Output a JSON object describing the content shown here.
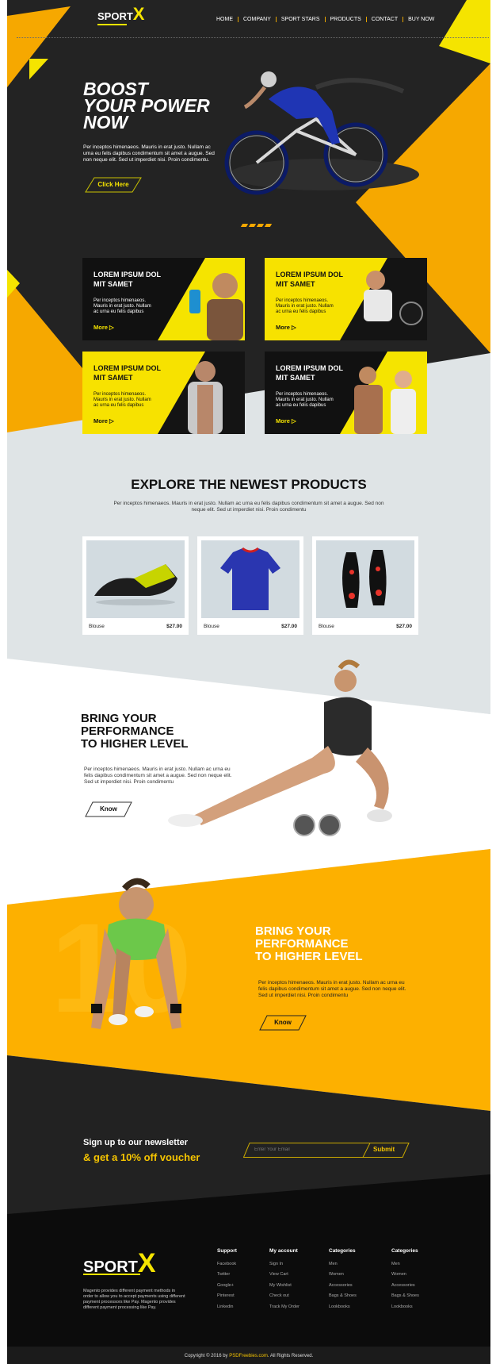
{
  "brand": {
    "name_a": "SPORT",
    "name_b": "X"
  },
  "nav": [
    "HOME",
    "COMPANY",
    "SPORT STARS",
    "PRODUCTS",
    "CONTACT",
    "BUY NOW"
  ],
  "hero": {
    "title_1": "BOOST",
    "title_2": "YOUR POWER",
    "title_3": "NOW",
    "text": "Per inceptos himenaeos. Mauris in erat justo. Nullam ac urna eu felis dapibus condimentum sit amet a augue. Sed non neque elit. Sed ut imperdiet nisi. Proin condimentu.",
    "button": "Click Here"
  },
  "cards": [
    {
      "title": "LOREM IPSUM DOL MIT SAMET",
      "text": "Per inceptos himenaeos. Mauris in erat justo. Nullam ac urna eu felis dapibus",
      "more": "More ▷"
    },
    {
      "title": "LOREM IPSUM DOL MIT SAMET",
      "text": "Per inceptos himenaeos. Mauris in erat justo. Nullam ac urna eu felis dapibus",
      "more": "More ▷"
    },
    {
      "title": "LOREM IPSUM DOL MIT SAMET",
      "text": "Per inceptos himenaeos. Mauris in erat justo. Nullam ac urna eu felis dapibus",
      "more": "More ▷"
    },
    {
      "title": "LOREM IPSUM DOL MIT SAMET",
      "text": "Per inceptos himenaeos. Mauris in erat justo. Nullam ac urna eu felis dapibus",
      "more": "More ▷"
    }
  ],
  "products": {
    "title": "EXPLORE THE NEWEST PRODUCTS",
    "text": "Per inceptos himenaeos. Mauris in erat justo. Nullam ac urna eu felis dapibus condimentum sit amet a augue. Sed non neque elit. Sed ut imperdiet nisi. Proin condimentu",
    "items": [
      {
        "name": "Blouse",
        "price": "$27.00"
      },
      {
        "name": "Blouse",
        "price": "$27.00"
      },
      {
        "name": "Blouse",
        "price": "$27.00"
      }
    ]
  },
  "section_white": {
    "title_1": "BRING YOUR",
    "title_2": "PERFORMANCE",
    "title_3": "TO HIGHER LEVEL",
    "text": "Per inceptos himenaeos. Mauris in erat justo. Nullam ac urna eu felis dapibus condimentum sit amet a augue. Sed non neque elit. Sed ut imperdiet nisi. Proin condimentu",
    "button": "Know"
  },
  "section_orange": {
    "title_1": "BRING YOUR",
    "title_2": "PERFORMANCE",
    "title_3": "TO HIGHER LEVEL",
    "text": "Per inceptos himenaeos. Mauris in erat justo. Nullam ac urna eu felis dapibus condimentum sit amet a augue. Sed non neque elit. Sed ut imperdiet nisi. Proin condimentu",
    "button": "Know",
    "bg_number": "10"
  },
  "newsletter": {
    "line_1": "Sign up to our newsletter",
    "line_2": "& get a 10% off voucher",
    "placeholder": "Enter Your Email",
    "submit": "Submit"
  },
  "footer": {
    "about": "Magento provides different payment methods in order to allow you to accept payments using different payment processors like Pay. Magento provides different payment processing like Pay.",
    "columns": [
      {
        "title": "Support",
        "items": [
          "Facebook",
          "Twitter",
          "Google+",
          "Pinterest",
          "Linkedin"
        ]
      },
      {
        "title": "My account",
        "items": [
          "Sign In",
          "View Cart",
          "My Wishlist",
          "Check out",
          "Track My Order"
        ]
      },
      {
        "title": "Categories",
        "items": [
          "Men",
          "Women",
          "Accessories",
          "Bags & Shoes",
          "Lookbooks"
        ]
      },
      {
        "title": "Categories",
        "items": [
          "Men",
          "Women",
          "Accessories",
          "Bags & Shoes",
          "Lookbooks"
        ]
      }
    ],
    "copyright_a": "Copyright © 2016 by ",
    "copyright_link": "PSDFreebies.com",
    "copyright_b": ". All Rights Reserved."
  },
  "colors": {
    "yellow": "#f5e400",
    "orange": "#f6a800",
    "dark": "#222222",
    "light": "#dfe4e6"
  }
}
